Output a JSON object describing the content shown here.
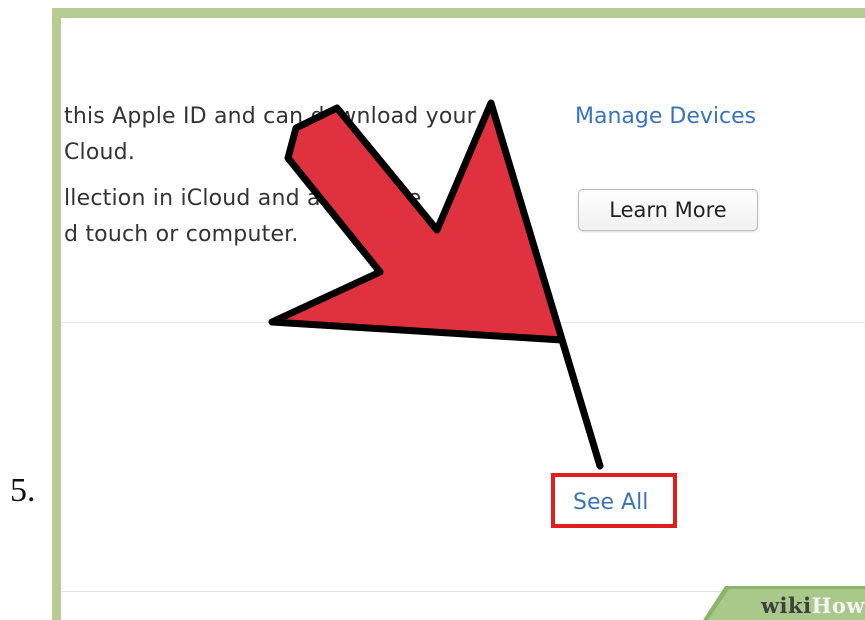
{
  "step": {
    "number": "5."
  },
  "content": {
    "line1": "this Apple ID and can download your",
    "line2": "Cloud.",
    "line3": "llection in iCloud and also share",
    "line4": "d touch or computer."
  },
  "links": {
    "manage_devices": "Manage Devices",
    "see_all": "See All"
  },
  "buttons": {
    "learn_more": "Learn More"
  },
  "watermark": {
    "part1": "wiki",
    "part2": "How"
  },
  "colors": {
    "arrow_fill": "#e0313e",
    "arrow_stroke": "#000000",
    "highlight": "#e01e1e",
    "link": "#3a74b6",
    "frame": "#b5cc94"
  },
  "icons": {
    "pointer": "red-arrow-icon"
  }
}
